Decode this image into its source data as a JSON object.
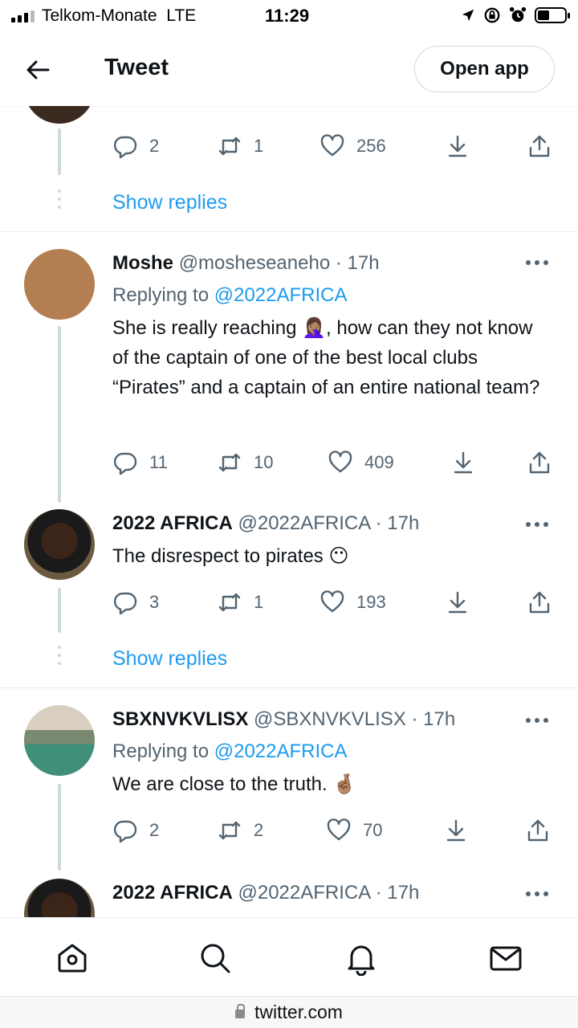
{
  "status_bar": {
    "carrier": "Telkom-Monate",
    "network": "LTE",
    "time": "11:29"
  },
  "header": {
    "title": "Tweet",
    "open_app_label": "Open app"
  },
  "top_tweet": {
    "replies": "2",
    "retweets": "1",
    "likes": "256"
  },
  "show_replies_label": "Show replies",
  "tweets": [
    {
      "name": "Moshe",
      "handle": "@mosheseaneho · 17h",
      "replying_prefix": "Replying to",
      "replying_to": "@2022AFRICA",
      "text": "She is really reaching 🤦🏽‍♀️, how can they not know of the captain of one of the best local clubs “Pirates” and a captain of an entire national team?",
      "replies": "11",
      "retweets": "10",
      "likes": "409"
    },
    {
      "name": "2022 AFRICA",
      "handle": "@2022AFRICA · 17h",
      "text": "The disrespect to pirates 😶",
      "replies": "3",
      "retweets": "1",
      "likes": "193"
    },
    {
      "name": "SBXNVKVLISX",
      "handle": "@SBXNVKVLISX · 17h",
      "replying_prefix": "Replying to",
      "replying_to": "@2022AFRICA",
      "text": "We are close to the truth. 🤞🏽",
      "replies": "2",
      "retweets": "2",
      "likes": "70"
    },
    {
      "name": "2022 AFRICA",
      "handle": "@2022AFRICA · 17h"
    }
  ],
  "url_bar": {
    "domain": "twitter.com"
  },
  "colors": {
    "link": "#1d9bf0",
    "muted": "#536471",
    "text": "#0f1419"
  },
  "icons": [
    "back-arrow-icon",
    "reply-icon",
    "retweet-icon",
    "like-icon",
    "download-icon",
    "share-icon",
    "home-icon",
    "search-icon",
    "notifications-icon",
    "messages-icon",
    "lock-icon"
  ]
}
